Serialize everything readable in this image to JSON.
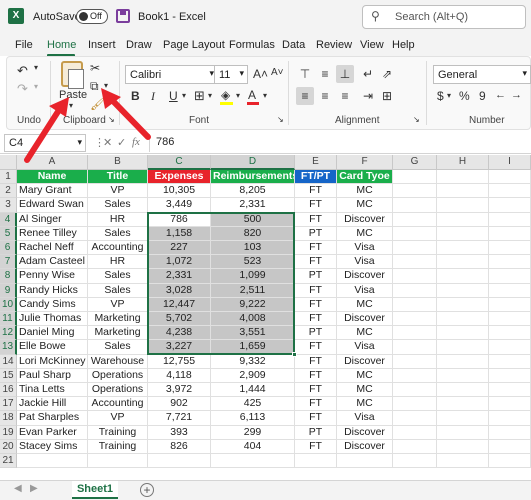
{
  "titlebar": {
    "app_icon": "excel-icon",
    "autosave_label": "AutoSave",
    "toggle_state": "Off",
    "doc_title": "Book1  -  Excel",
    "search_placeholder": "Search (Alt+Q)"
  },
  "menu": [
    "File",
    "Home",
    "Insert",
    "Draw",
    "Page Layout",
    "Formulas",
    "Data",
    "Review",
    "View",
    "Help"
  ],
  "ribbon": {
    "paste_label": "Paste",
    "font_name": "Calibri",
    "font_size": "11",
    "number_format": "General",
    "groups": {
      "undo": "Undo",
      "clipboard": "Clipboard",
      "font": "Font",
      "alignment": "Alignment",
      "number": "Number"
    },
    "font_buttons": {
      "bold": "B",
      "italic": "I",
      "underline": "U",
      "grow": "A˄",
      "shrink": "A˅"
    },
    "number_buttons": {
      "currency": "$",
      "percent": "%",
      "comma": "9"
    }
  },
  "formula_bar": {
    "name_box": "C4",
    "fx": "fx",
    "value": "786"
  },
  "columns": [
    "A",
    "B",
    "C",
    "D",
    "E",
    "F",
    "G",
    "H",
    "I"
  ],
  "rows": [
    "1",
    "2",
    "3",
    "4",
    "5",
    "6",
    "7",
    "8",
    "9",
    "10",
    "11",
    "12",
    "13",
    "14",
    "15",
    "16",
    "17",
    "18",
    "19",
    "20",
    "21"
  ],
  "headers": {
    "name": "Name",
    "title": "Title",
    "expenses": "Expenses",
    "reimbursements": "Reimbursements",
    "ftpt": "FT/PT",
    "card": "Card Tyoe"
  },
  "header_colors": {
    "green": "#1aae4b",
    "red": "#e8232b",
    "blue": "#1565c8"
  },
  "table": [
    [
      "Mary Grant",
      "VP",
      "10,305",
      "8,205",
      "FT",
      "MC"
    ],
    [
      "Edward Swan",
      "Sales",
      "3,449",
      "2,331",
      "FT",
      "MC"
    ],
    [
      "Al Singer",
      "HR",
      "786",
      "500",
      "FT",
      "Discover"
    ],
    [
      "Renee Tilley",
      "Sales",
      "1,158",
      "820",
      "PT",
      "MC"
    ],
    [
      "Rachel Neff",
      "Accounting",
      "227",
      "103",
      "FT",
      "Visa"
    ],
    [
      "Adam Casteel",
      "HR",
      "1,072",
      "523",
      "FT",
      "Visa"
    ],
    [
      "Penny Wise",
      "Sales",
      "2,331",
      "1,099",
      "PT",
      "Discover"
    ],
    [
      "Randy Hicks",
      "Sales",
      "3,028",
      "2,511",
      "FT",
      "Visa"
    ],
    [
      "Candy Sims",
      "VP",
      "12,447",
      "9,222",
      "FT",
      "MC"
    ],
    [
      "Julie Thomas",
      "Marketing",
      "5,702",
      "4,008",
      "FT",
      "Discover"
    ],
    [
      "Daniel Ming",
      "Marketing",
      "4,238",
      "3,551",
      "PT",
      "MC"
    ],
    [
      "Elle Bowe",
      "Sales",
      "3,227",
      "1,659",
      "FT",
      "Visa"
    ],
    [
      "Lori McKinney",
      "Warehouse",
      "12,755",
      "9,332",
      "FT",
      "Discover"
    ],
    [
      "Paul Sharp",
      "Operations",
      "4,118",
      "2,909",
      "FT",
      "MC"
    ],
    [
      "Tina Letts",
      "Operations",
      "3,972",
      "1,444",
      "FT",
      "MC"
    ],
    [
      "Jackie Hill",
      "Accounting",
      "902",
      "425",
      "FT",
      "MC"
    ],
    [
      "Pat Sharples",
      "VP",
      "7,721",
      "6,113",
      "FT",
      "Visa"
    ],
    [
      "Evan Parker",
      "Training",
      "393",
      "299",
      "PT",
      "Discover"
    ],
    [
      "Stacey Sims",
      "Training",
      "826",
      "404",
      "FT",
      "Discover"
    ]
  ],
  "sheet": {
    "tab": "Sheet1",
    "add": "+"
  },
  "accent": "#1e7145"
}
